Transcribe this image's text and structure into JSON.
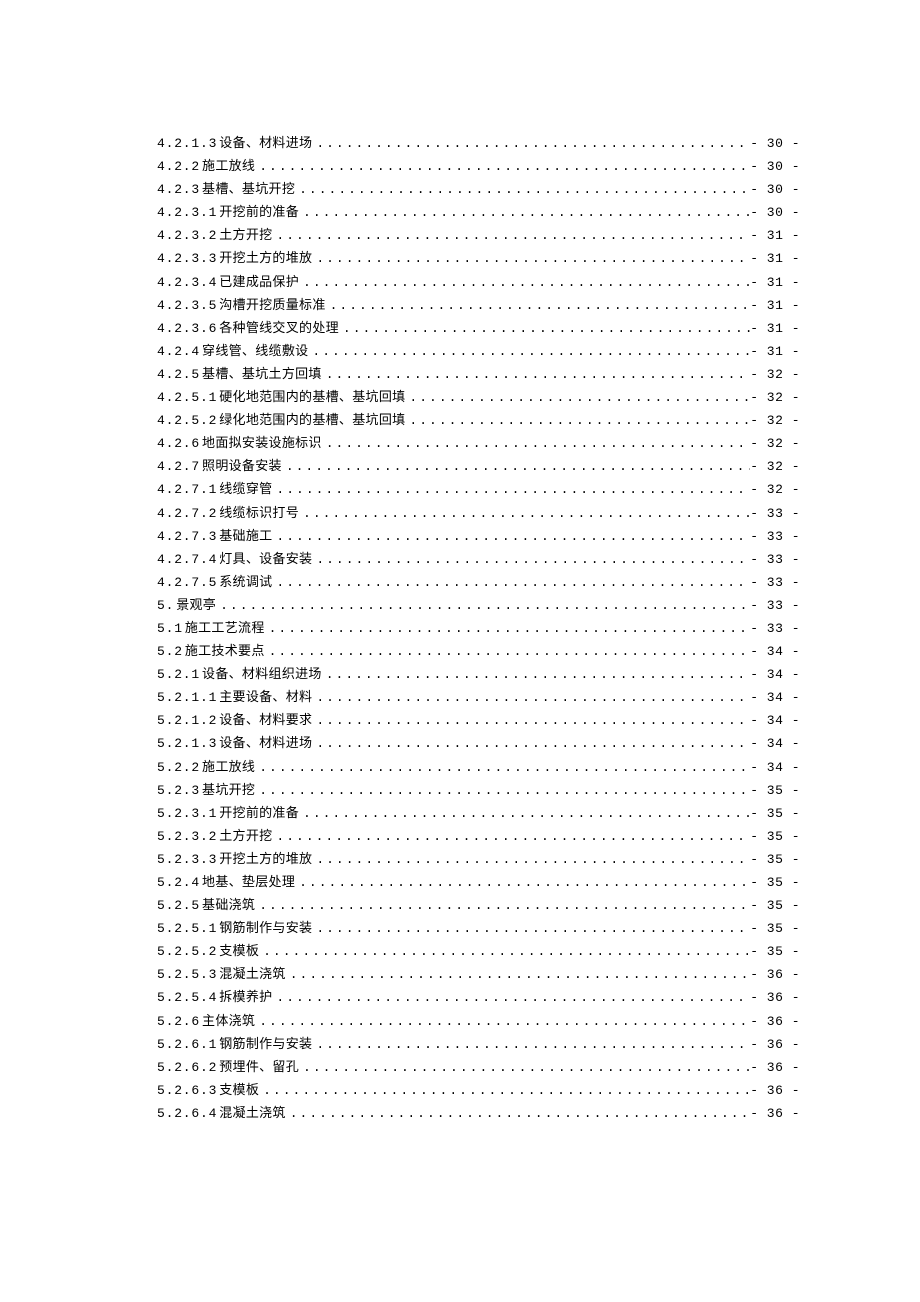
{
  "toc": [
    {
      "num": "4.2.1.3",
      "title": "设备、材料进场",
      "page": "- 30 -"
    },
    {
      "num": "4.2.2",
      "title": "施工放线",
      "page": "- 30 -"
    },
    {
      "num": "4.2.3",
      "title": "基槽、基坑开挖",
      "page": "- 30 -"
    },
    {
      "num": "4.2.3.1",
      "title": "开挖前的准备",
      "page": "- 30 -"
    },
    {
      "num": "4.2.3.2",
      "title": "土方开挖",
      "page": "- 31 -"
    },
    {
      "num": "4.2.3.3",
      "title": "开挖土方的堆放",
      "page": "- 31 -"
    },
    {
      "num": "4.2.3.4",
      "title": "已建成品保护",
      "page": "- 31 -"
    },
    {
      "num": "4.2.3.5",
      "title": "沟槽开挖质量标准",
      "page": "- 31 -"
    },
    {
      "num": "4.2.3.6",
      "title": "各种管线交叉的处理",
      "page": "- 31 -"
    },
    {
      "num": "4.2.4",
      "title": "穿线管、线缆敷设",
      "page": "- 31 -"
    },
    {
      "num": "4.2.5",
      "title": "基槽、基坑土方回填",
      "page": "- 32 -"
    },
    {
      "num": "4.2.5.1",
      "title": "硬化地范围内的基槽、基坑回填",
      "page": "- 32 -"
    },
    {
      "num": "4.2.5.2",
      "title": "绿化地范围内的基槽、基坑回填",
      "page": "- 32 -"
    },
    {
      "num": "4.2.6",
      "title": "地面拟安装设施标识",
      "page": "- 32 -"
    },
    {
      "num": "4.2.7",
      "title": "照明设备安装",
      "page": "- 32 -"
    },
    {
      "num": "4.2.7.1",
      "title": "线缆穿管",
      "page": "- 32 -"
    },
    {
      "num": "4.2.7.2",
      "title": "线缆标识打号",
      "page": "- 33 -"
    },
    {
      "num": "4.2.7.3",
      "title": "基础施工",
      "page": "- 33 -"
    },
    {
      "num": "4.2.7.4",
      "title": "灯具、设备安装",
      "page": "- 33 -"
    },
    {
      "num": "4.2.7.5",
      "title": "系统调试",
      "page": "- 33 -"
    },
    {
      "num": "5.",
      "title": "景观亭",
      "page": "- 33 -"
    },
    {
      "num": "5.1",
      "title": "施工工艺流程",
      "page": "- 33 -"
    },
    {
      "num": "5.2",
      "title": "施工技术要点",
      "page": "- 34 -"
    },
    {
      "num": "5.2.1",
      "title": "设备、材料组织进场",
      "page": "- 34 -"
    },
    {
      "num": "5.2.1.1",
      "title": "主要设备、材料",
      "page": "- 34 -"
    },
    {
      "num": "5.2.1.2",
      "title": "设备、材料要求",
      "page": "- 34 -"
    },
    {
      "num": "5.2.1.3",
      "title": "设备、材料进场",
      "page": "- 34 -"
    },
    {
      "num": "5.2.2",
      "title": "施工放线",
      "page": "- 34 -"
    },
    {
      "num": "5.2.3",
      "title": "基坑开挖",
      "page": "- 35 -"
    },
    {
      "num": "5.2.3.1",
      "title": "开挖前的准备",
      "page": "- 35 -"
    },
    {
      "num": "5.2.3.2",
      "title": "土方开挖",
      "page": "- 35 -"
    },
    {
      "num": "5.2.3.3",
      "title": "开挖土方的堆放",
      "page": "- 35 -"
    },
    {
      "num": "5.2.4",
      "title": "地基、垫层处理",
      "page": "- 35 -"
    },
    {
      "num": "5.2.5",
      "title": "基础浇筑",
      "page": "- 35 -"
    },
    {
      "num": "5.2.5.1",
      "title": "钢筋制作与安装",
      "page": "- 35 -"
    },
    {
      "num": "5.2.5.2",
      "title": "支模板",
      "page": "- 35 -"
    },
    {
      "num": "5.2.5.3",
      "title": "混凝土浇筑",
      "page": "- 36 -"
    },
    {
      "num": "5.2.5.4",
      "title": "拆模养护",
      "page": "- 36 -"
    },
    {
      "num": "5.2.6",
      "title": "主体浇筑",
      "page": "- 36 -"
    },
    {
      "num": "5.2.6.1",
      "title": "钢筋制作与安装",
      "page": "- 36 -"
    },
    {
      "num": "5.2.6.2",
      "title": "预埋件、留孔",
      "page": "- 36 -"
    },
    {
      "num": "5.2.6.3",
      "title": "支模板",
      "page": "- 36 -"
    },
    {
      "num": "5.2.6.4",
      "title": "混凝土浇筑",
      "page": "- 36 -"
    }
  ]
}
